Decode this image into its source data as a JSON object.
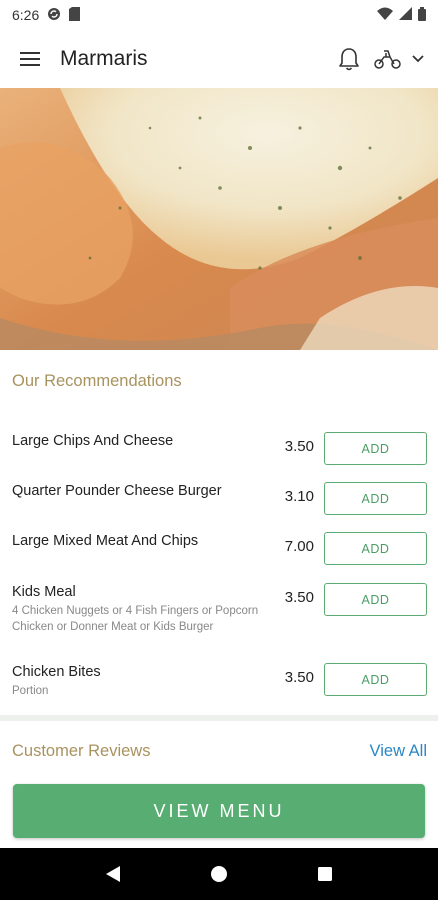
{
  "status_bar": {
    "time": "6:26",
    "icons": [
      "sync-icon",
      "sim-card-icon",
      "wifi-icon",
      "signal-icon",
      "battery-icon"
    ]
  },
  "app_bar": {
    "title": "Marmaris",
    "icons": [
      "menu-icon",
      "bell-icon",
      "scooter-icon",
      "chevron-down-icon"
    ]
  },
  "hero": {
    "alt": "Cheese pizza close-up"
  },
  "recommendations": {
    "title": "Our Recommendations",
    "add_label": "ADD",
    "items": [
      {
        "name": "Large Chips And Cheese",
        "description": "",
        "price": "3.50"
      },
      {
        "name": "Quarter Pounder Cheese Burger",
        "description": "",
        "price": "3.10"
      },
      {
        "name": "Large Mixed Meat And Chips",
        "description": "",
        "price": "7.00"
      },
      {
        "name": "Kids Meal",
        "description": "4 Chicken Nuggets or 4 Fish Fingers or Popcorn Chicken or Donner Meat or Kids Burger",
        "price": "3.50"
      },
      {
        "name": "Chicken Bites",
        "description": "Portion",
        "price": "3.50"
      }
    ]
  },
  "reviews": {
    "title": "Customer Reviews",
    "view_all": "View All"
  },
  "view_menu_label": "VIEW MENU",
  "colors": {
    "accent_green": "#58ae72",
    "section_title": "#a8925f",
    "link_blue": "#2b86c5"
  },
  "nav_bar": {
    "icons": [
      "back-icon",
      "home-icon",
      "recents-icon"
    ]
  }
}
